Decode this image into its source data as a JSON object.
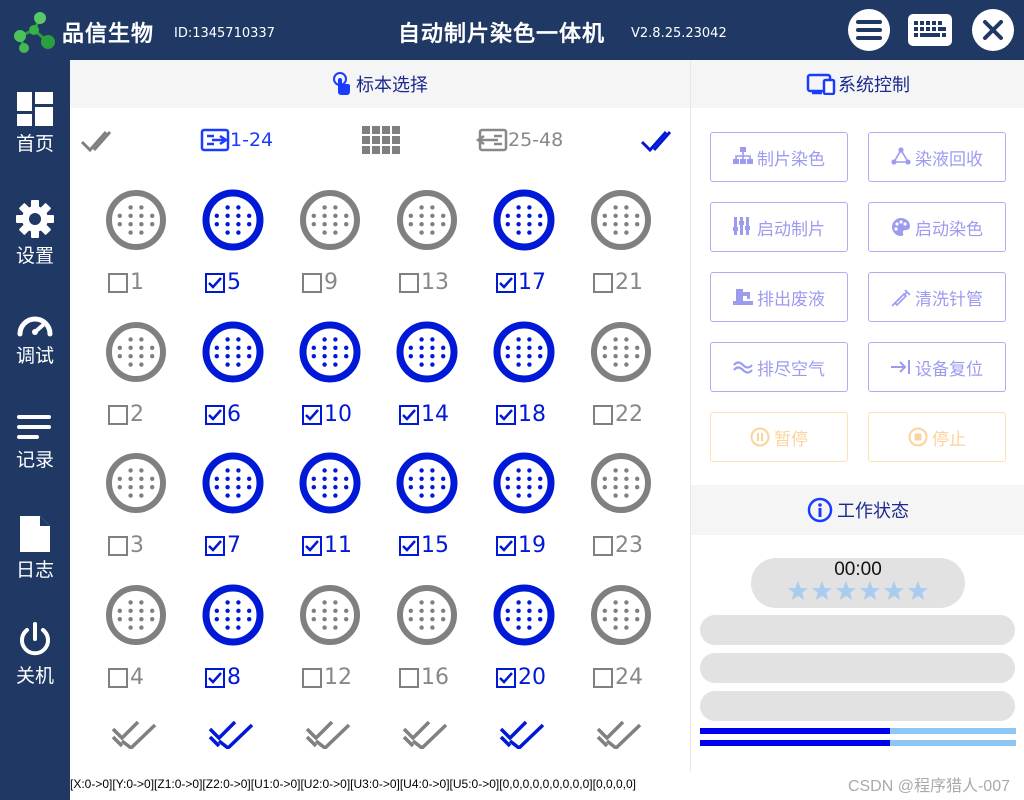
{
  "header": {
    "brand": "品信生物",
    "device_id": "ID:1345710337",
    "title": "自动制片染色一体机",
    "version": "V2.8.25.23042"
  },
  "sidebar": {
    "items": [
      {
        "label": "首页",
        "icon": "dashboard-icon"
      },
      {
        "label": "设置",
        "icon": "gear-icon"
      },
      {
        "label": "调试",
        "icon": "gauge-icon"
      },
      {
        "label": "记录",
        "icon": "list-lines-icon"
      },
      {
        "label": "日志",
        "icon": "document-icon"
      },
      {
        "label": "关机",
        "icon": "power-icon"
      }
    ]
  },
  "specimen": {
    "title": "标本选择",
    "range_a": "1-24",
    "range_b": "25-48",
    "slides": [
      {
        "num": "1",
        "checked": false
      },
      {
        "num": "2",
        "checked": false
      },
      {
        "num": "3",
        "checked": false
      },
      {
        "num": "4",
        "checked": false
      },
      {
        "num": "5",
        "checked": true
      },
      {
        "num": "6",
        "checked": true
      },
      {
        "num": "7",
        "checked": true
      },
      {
        "num": "8",
        "checked": true
      },
      {
        "num": "9",
        "checked": false
      },
      {
        "num": "10",
        "checked": true
      },
      {
        "num": "11",
        "checked": true
      },
      {
        "num": "12",
        "checked": false
      },
      {
        "num": "13",
        "checked": false
      },
      {
        "num": "14",
        "checked": true
      },
      {
        "num": "15",
        "checked": true
      },
      {
        "num": "16",
        "checked": false
      },
      {
        "num": "17",
        "checked": true
      },
      {
        "num": "18",
        "checked": true
      },
      {
        "num": "19",
        "checked": true
      },
      {
        "num": "20",
        "checked": true
      },
      {
        "num": "21",
        "checked": false
      },
      {
        "num": "22",
        "checked": false
      },
      {
        "num": "23",
        "checked": false
      },
      {
        "num": "24",
        "checked": false
      }
    ],
    "column_all_checked": [
      false,
      true,
      false,
      false,
      true,
      false
    ]
  },
  "control": {
    "title": "系统控制",
    "buttons": [
      {
        "label": "制片染色",
        "icon": "sitemap-icon"
      },
      {
        "label": "染液回收",
        "icon": "recycle-nodes-icon"
      },
      {
        "label": "启动制片",
        "icon": "sliders-icon"
      },
      {
        "label": "启动染色",
        "icon": "palette-icon"
      },
      {
        "label": "排出废液",
        "icon": "faucet-icon"
      },
      {
        "label": "清洗针管",
        "icon": "syringe-icon"
      },
      {
        "label": "排尽空气",
        "icon": "wind-icon"
      },
      {
        "label": "设备复位",
        "icon": "arrow-to-line-icon"
      },
      {
        "label": "暂停",
        "icon": "pause-circle-icon"
      },
      {
        "label": "停止",
        "icon": "stop-circle-icon"
      }
    ]
  },
  "status": {
    "title": "工作状态",
    "timer": "00:00",
    "stars": 6,
    "progress": 0.6
  },
  "footer": {
    "coords": "[X:0->0][Y:0->0][Z1:0->0][Z2:0->0][U1:0->0][U2:0->0][U3:0->0][U4:0->0][U5:0->0][0,0,0,0,0,0,0,0,0][0,0,0,0]",
    "watermark": "CSDN @程序猎人-007"
  },
  "colors": {
    "navy": "#1f3864",
    "selected_blue": "#0019d6",
    "unselected_gray": "#808080",
    "button_lavender": "#9d9bf0",
    "warn_orange": "#fcd39a",
    "progress_blue": "#0000f0",
    "progress_light": "#8ec7f3"
  }
}
